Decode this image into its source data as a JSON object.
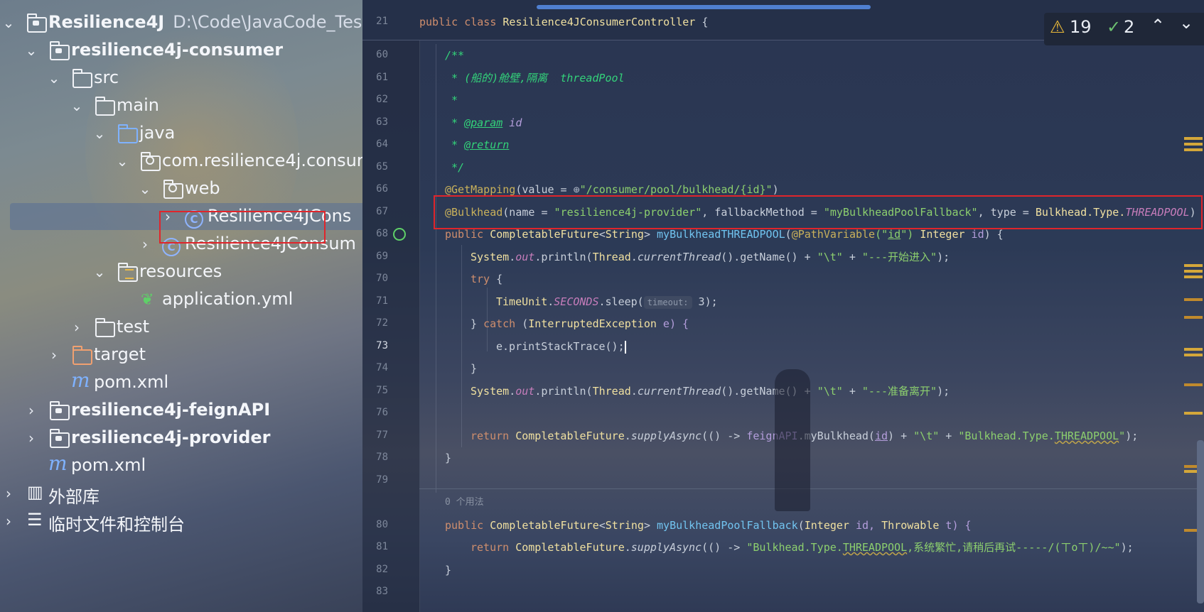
{
  "project_tree": {
    "root": {
      "name": "Resilience4J",
      "path": "D:\\Code\\JavaCode_Test\\"
    },
    "consumer_module": "resilience4j-consumer",
    "src": "src",
    "main": "main",
    "java": "java",
    "package": "com.resilience4j.consur",
    "web": "web",
    "controller_file": "Resilience4JCons",
    "main_class_file": "Resilience4JConsum",
    "resources": "resources",
    "application_yml": "application.yml",
    "test": "test",
    "target": "target",
    "consumer_pom": "pom.xml",
    "feign_module": "resilience4j-feignAPI",
    "provider_module": "resilience4j-provider",
    "root_pom": "pom.xml",
    "external_libs": "外部库",
    "scratches": "临时文件和控制台"
  },
  "icons": {
    "chevron_expanded": "chevron-down-icon",
    "chevron_collapsed": "chevron-right-icon",
    "folder": "folder-icon",
    "module": "module-folder-icon",
    "package": "package-icon",
    "class": "class-icon",
    "spring_boot": "spring-boot-icon",
    "maven": "maven-icon",
    "library": "library-icon",
    "scratches": "scratches-icon",
    "warning": "warning-icon",
    "check": "check-icon"
  },
  "inspection": {
    "warnings": "19",
    "weak_warnings": "2"
  },
  "editor": {
    "sticky_line": "21",
    "line_numbers": [
      "60",
      "61",
      "62",
      "63",
      "64",
      "65",
      "66",
      "67",
      "68",
      "69",
      "70",
      "71",
      "72",
      "73",
      "74",
      "75",
      "76",
      "77",
      "78",
      "79",
      "80",
      "81",
      "82",
      "83"
    ],
    "current_line": "73",
    "usage_hint": "0 个用法",
    "code": {
      "l21_kw": "public class ",
      "l21_cls": "Resilience4JConsumerController",
      "l21_rest": " {",
      "l60": "/**",
      "l61_a": " * (船的)舱壁,隔离",
      "l61_b": "  threadPool",
      "l62": " *",
      "l63_a": " * ",
      "l63_tag": "@param",
      "l63_p": " id",
      "l64_a": " * ",
      "l64_tag": "@return",
      "l65": " */",
      "l66_a": "@GetMapping",
      "l66_b": "(value = ",
      "l66_glob": "⊕",
      "l66_c": "\"/consumer/pool/bulkhead/{id}\"",
      "l66_d": ")",
      "l67_a": "@Bulkhead",
      "l67_b": "(name = ",
      "l67_c": "\"resilience4j-provider\"",
      "l67_d": ", fallbackMethod = ",
      "l67_e": "\"myBulkheadPoolFallback\"",
      "l67_f": ", type = ",
      "l67_g": "Bulkhead.Type.",
      "l67_h": "THREADPOOL",
      "l67_i": ")",
      "l68_a": "public ",
      "l68_b": "CompletableFuture",
      "l68_c": "<",
      "l68_d": "String",
      "l68_e": "> ",
      "l68_f": "myBulkheadTHREADPOOL",
      "l68_g": "(",
      "l68_h": "@PathVariable",
      "l68_i": "(\"",
      "l68_j": "id",
      "l68_k": "\") ",
      "l68_l": "Integer",
      "l68_m": " id",
      "l68_n": ") {",
      "l69_a": "System",
      "l69_b": ".",
      "l69_c": "out",
      "l69_d": ".println(",
      "l69_e": "Thread",
      "l69_f": ".",
      "l69_g": "currentThread",
      "l69_h": "().getName() + ",
      "l69_i": "\"\\t\"",
      "l69_j": " + ",
      "l69_k": "\"---开始进入\"",
      "l69_l": ");",
      "l70_a": "try",
      "l70_b": " {",
      "l71_a": "TimeUnit",
      "l71_b": ".",
      "l71_c": "SECONDS",
      "l71_d": ".sleep(",
      "l71_hint": "timeout:",
      "l71_e": " 3);",
      "l72_a": "} ",
      "l72_b": "catch",
      "l72_c": " (",
      "l72_d": "InterruptedException",
      "l72_e": " e) {",
      "l73_a": "e.printStackTrace",
      "l73_b": "();",
      "l74": "}",
      "l75_k": "\"---准备离开\"",
      "l77_a": "return ",
      "l77_b": "CompletableFuture",
      "l77_c": ".",
      "l77_d": "supplyAsync",
      "l77_e": "(() -> ",
      "l77_f": "feignAPI",
      "l77_g": ".myBulkhead(",
      "l77_h": "id",
      "l77_i": ") + ",
      "l77_j": "\"\\t\"",
      "l77_k": " + ",
      "l77_l": "\"Bulkhead.Type.",
      "l77_m": "THREADPOOL",
      "l77_n": "\"",
      "l77_o": ");",
      "l78": "}",
      "l80_a": "public ",
      "l80_b": "CompletableFuture",
      "l80_c": "<",
      "l80_d": "String",
      "l80_e": "> ",
      "l80_f": "myBulkheadPoolFallback",
      "l80_g": "(",
      "l80_h": "Integer",
      "l80_i": " id, ",
      "l80_j": "Throwable",
      "l80_k": " t) {",
      "l81_a": "return ",
      "l81_b": "CompletableFuture",
      "l81_c": ".",
      "l81_d": "supplyAsync",
      "l81_e": "(() -> ",
      "l81_f": "\"Bulkhead.Type.",
      "l81_g": "THREADPOOL",
      "l81_h": ",系统繁忙,请稍后再试-----/(ㄒoㄒ)/~~\"",
      "l81_i": ");",
      "l82": "}"
    }
  },
  "colors": {
    "highlight_box": "#e0252b",
    "selection": "#58709a"
  }
}
